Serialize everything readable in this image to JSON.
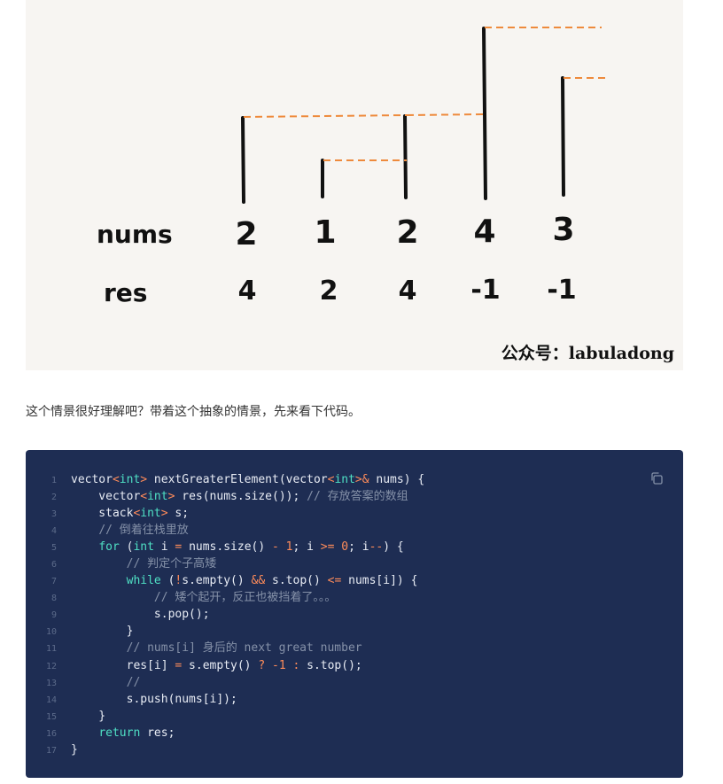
{
  "figure": {
    "row_labels": {
      "nums": "nums",
      "res": "res"
    },
    "nums": [
      "2",
      "1",
      "2",
      "4",
      "3"
    ],
    "res": [
      "4",
      "2",
      "4",
      "-1",
      "-1"
    ],
    "watermark": "公众号：labuladong",
    "colors": {
      "bar": "#111111",
      "dashed": "#ee8a3c",
      "background": "#f7f5f2"
    }
  },
  "caption": "这个情景很好理解吧？带着这个抽象的情景，先来看下代码。",
  "code_block": {
    "copy_icon": "copy-icon",
    "colors": {
      "background": "#1e2d53",
      "text": "#e8ecf4",
      "keyword": "#4fe0c4",
      "operator": "#ff8c5a",
      "comment": "#8591a8",
      "line_number": "#5c6b8a"
    },
    "lines": [
      "vector<int> nextGreaterElement(vector<int>& nums) {",
      "    vector<int> res(nums.size()); // 存放答案的数组",
      "    stack<int> s;",
      "    // 倒着往栈里放",
      "    for (int i = nums.size() - 1; i >= 0; i--) {",
      "        // 判定个子高矮",
      "        while (!s.empty() && s.top() <= nums[i]) {",
      "            // 矮个起开，反正也被挡着了。。。",
      "            s.pop();",
      "        }",
      "        // nums[i] 身后的 next great number",
      "        res[i] = s.empty() ? -1 : s.top();",
      "        //",
      "        s.push(nums[i]);",
      "    }",
      "    return res;",
      "}"
    ]
  }
}
